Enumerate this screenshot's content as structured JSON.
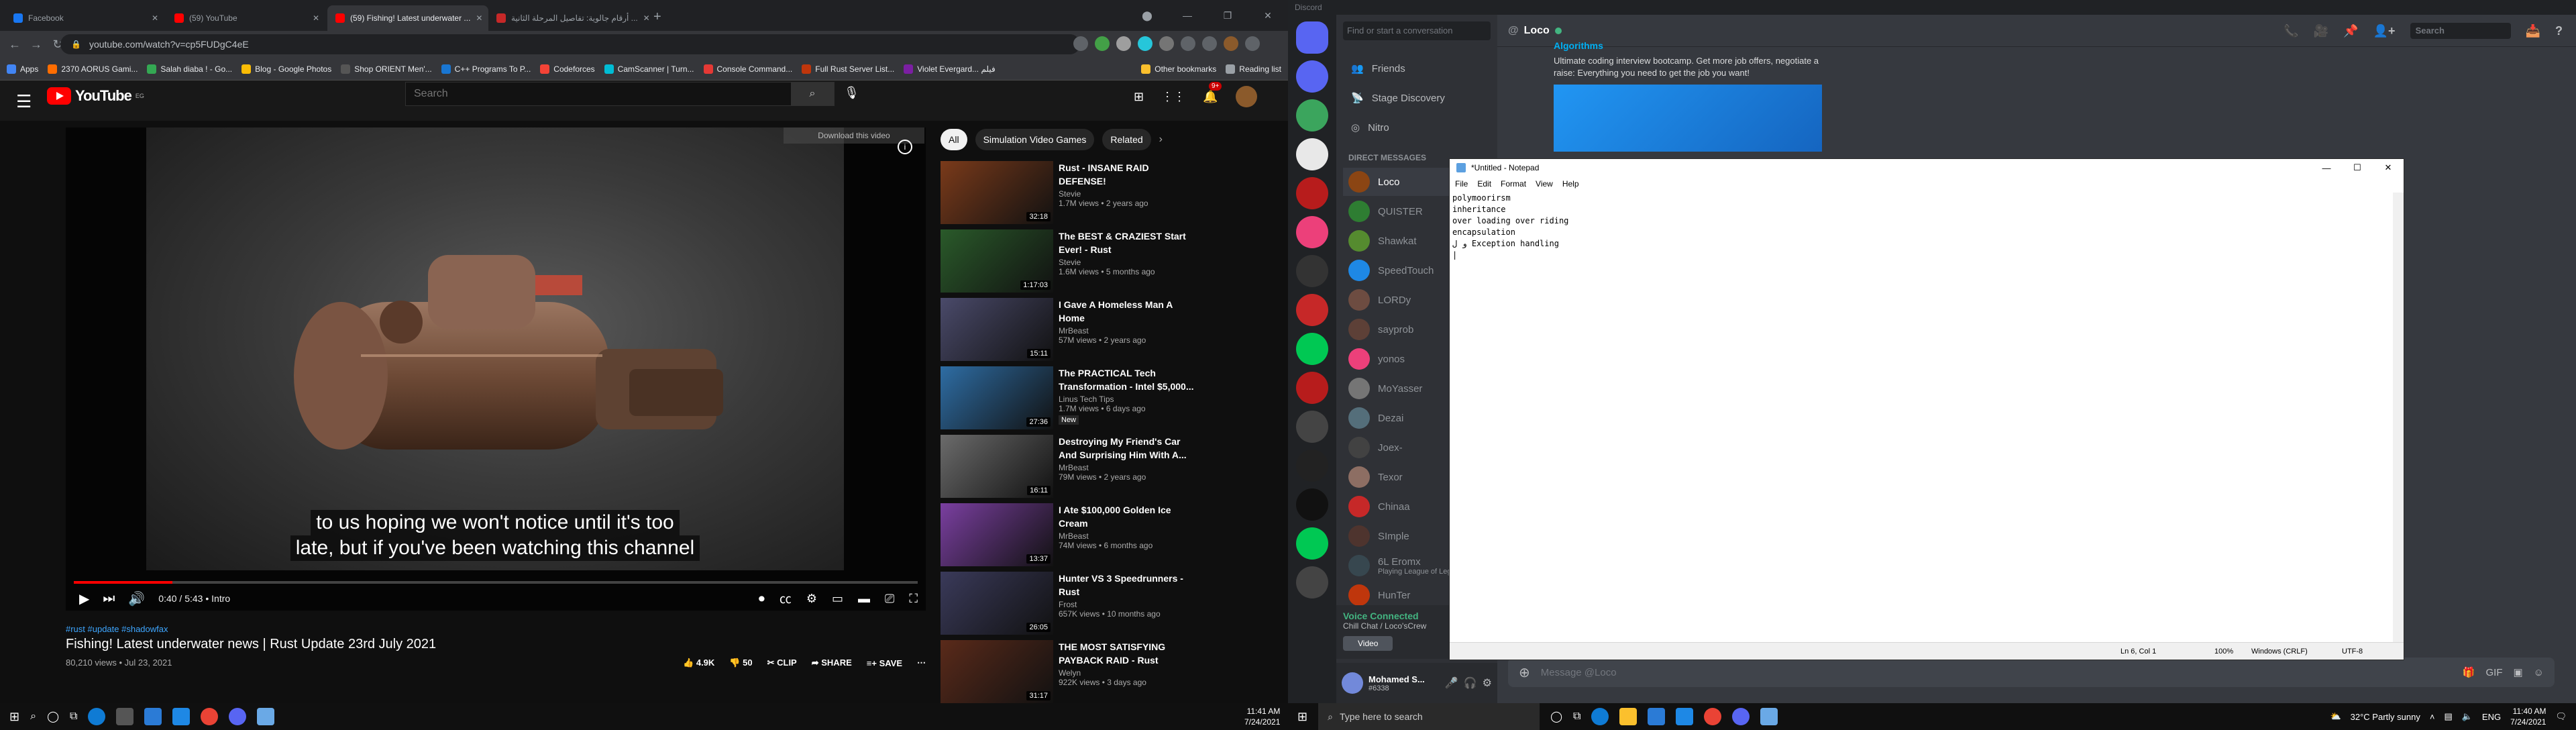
{
  "chrome": {
    "tabs": [
      {
        "label": "Facebook",
        "color": "#1877f2",
        "active": false
      },
      {
        "label": "(59) YouTube",
        "color": "#ff0000",
        "active": false
      },
      {
        "label": "(59) Fishing! Latest underwater ...",
        "color": "#ff0000",
        "active": true
      },
      {
        "label": "أرقام جالوية: تفاصيل المرحلة الثانية ...",
        "color": "#c62828",
        "active": false
      }
    ],
    "url": "youtube.com/watch?v=cp5FUDgC4eE",
    "bookmarks": [
      {
        "label": "Apps",
        "color": "#4285f4"
      },
      {
        "label": "2370 AORUS Gami...",
        "color": "#ff6d00"
      },
      {
        "label": "Salah diaba ! - Go...",
        "color": "#34a853"
      },
      {
        "label": "Blog - Google Photos",
        "color": "#fbbc05"
      },
      {
        "label": "Shop ORIENT Men'...",
        "color": "#555555"
      },
      {
        "label": "C++ Programs To P...",
        "color": "#1976d2"
      },
      {
        "label": "Codeforces",
        "color": "#f44336"
      },
      {
        "label": "CamScanner | Turn...",
        "color": "#00bcd4"
      },
      {
        "label": "Console Command...",
        "color": "#e53935"
      },
      {
        "label": "Full Rust Server List...",
        "color": "#bf360c"
      },
      {
        "label": "Violet Evergard... فيلم",
        "color": "#7b1fa2"
      }
    ],
    "other_bookmarks": "Other bookmarks",
    "reading_list": "Reading list"
  },
  "youtube": {
    "logo_text": "YouTube",
    "logo_country": "EG",
    "search_placeholder": "Search",
    "notif_count": "9+",
    "download_banner": "Download this video",
    "caption_line1": "to us hoping we won't notice until it's too",
    "caption_line2": "late, but if you've been watching this channel",
    "time": "0:40 / 5:43 • Intro",
    "progress": 0.117,
    "tags": "#rust #update #shadowfax",
    "title": "Fishing! Latest underwater news | Rust Update 23rd July 2021",
    "stats": "80,210 views • Jul 23, 2021",
    "likes": "4.9K",
    "dislikes": "50",
    "clip": "CLIP",
    "share": "SHARE",
    "save": "SAVE",
    "chips": [
      "All",
      "Simulation Video Games",
      "Related"
    ],
    "related": [
      {
        "title": "Rust - INSANE RAID DEFENSE!",
        "channel": "Stevie",
        "views": "1.7M views • 2 years ago",
        "duration": "32:18",
        "color": "#7a3a1a",
        "new": ""
      },
      {
        "title": "The BEST & CRAZIEST Start Ever! - Rust",
        "channel": "Stevie",
        "views": "1.6M views • 5 months ago",
        "duration": "1:17:03",
        "color": "#2a5a2a",
        "new": ""
      },
      {
        "title": "I Gave A Homeless Man A Home",
        "channel": "MrBeast",
        "views": "57M views • 2 years ago",
        "duration": "15:11",
        "color": "#4a4a6a",
        "new": ""
      },
      {
        "title": "The PRACTICAL Tech Transformation - Intel $5,000...",
        "channel": "Linus Tech Tips",
        "views": "1.7M views • 6 days ago",
        "duration": "27:36",
        "color": "#2e6da4",
        "new": "New"
      },
      {
        "title": "Destroying My Friend's Car And Surprising Him With A...",
        "channel": "MrBeast",
        "views": "79M views • 2 years ago",
        "duration": "16:11",
        "color": "#6b6b6b",
        "new": ""
      },
      {
        "title": "I Ate $100,000 Golden Ice Cream",
        "channel": "MrBeast",
        "views": "74M views • 6 months ago",
        "duration": "13:37",
        "color": "#7a3fa0",
        "new": ""
      },
      {
        "title": "Hunter VS 3 Speedrunners - Rust",
        "channel": "Frost",
        "views": "657K views • 10 months ago",
        "duration": "26:05",
        "color": "#3a3a5a",
        "new": ""
      },
      {
        "title": "THE MOST SATISFYING PAYBACK RAID - Rust",
        "channel": "Welyn",
        "views": "922K views • 3 days ago",
        "duration": "31:17",
        "color": "#5a2a1a",
        "new": ""
      }
    ]
  },
  "discord": {
    "window_title": "Discord",
    "search_placeholder": "Find or start a conversation",
    "nav": [
      "Friends",
      "Stage Discovery",
      "Nitro"
    ],
    "dm_header": "DIRECT MESSAGES",
    "dms": [
      {
        "name": "Loco",
        "color": "#8b4513",
        "sub": ""
      },
      {
        "name": "QUISTER",
        "color": "#2e7d32",
        "sub": ""
      },
      {
        "name": "Shawkat",
        "color": "#558b2f",
        "sub": ""
      },
      {
        "name": "SpeedTouch",
        "color": "#1e88e5",
        "sub": ""
      },
      {
        "name": "LORDy",
        "color": "#6d4c41",
        "sub": ""
      },
      {
        "name": "sayprob",
        "color": "#5d4037",
        "sub": ""
      },
      {
        "name": "yonos",
        "color": "#ec407a",
        "sub": ""
      },
      {
        "name": "MoYasser",
        "color": "#757575",
        "sub": ""
      },
      {
        "name": "Dezai",
        "color": "#546e7a",
        "sub": ""
      },
      {
        "name": "Joex-",
        "color": "#424242",
        "sub": ""
      },
      {
        "name": "Texor",
        "color": "#8d6e63",
        "sub": ""
      },
      {
        "name": "Chinaa",
        "color": "#c62828",
        "sub": ""
      },
      {
        "name": "SImple",
        "color": "#4e342e",
        "sub": ""
      },
      {
        "name": "6L Eromx",
        "color": "#37474f",
        "sub": "Playing League of Leg..."
      },
      {
        "name": "HunTer",
        "color": "#bf360c",
        "sub": ""
      }
    ],
    "voice_status": "Voice Connected",
    "voice_channel": "Chill Chat / Loco'sCrew",
    "voice_video": "Video",
    "user_name": "Mohamed S...",
    "user_tag": "#6338",
    "chat_user": "Loco",
    "chat_search": "Search",
    "embed_name": "Algorithms",
    "embed_desc": "Ultimate coding interview bootcamp. Get more job offers, negotiate a raise: Everything you need to get the job you want!",
    "message_placeholder": "Message @Loco",
    "server_colors": [
      "#5865f2",
      "#5865f2",
      "#3ba55d",
      "#e8e8e8",
      "#b71c1c",
      "#ec407a",
      "#333333",
      "#c62828",
      "#00c853",
      "#b71c1c",
      "#444444",
      "#222222",
      "#111111",
      "#00c853",
      "#444444"
    ]
  },
  "notepad": {
    "title": "*Untitled - Notepad",
    "menu": [
      "File",
      "Edit",
      "Format",
      "View",
      "Help"
    ],
    "text": "polymoorirsm\ninheritance\nover loading over riding\nencapsulation\nو ل Exception handling\n|",
    "status_pos": "Ln 6, Col 1",
    "status_zoom": "100%",
    "status_eol": "Windows (CRLF)",
    "status_enc": "UTF-8"
  },
  "taskbar": {
    "search_placeholder": "Type here to search",
    "clock_time_left": "11:41 AM",
    "clock_date_left": "7/24/2021",
    "weather": "32°C  Partly sunny",
    "lang": "ENG",
    "clock_time_right": "11:40 AM",
    "clock_date_right": "7/24/2021"
  }
}
